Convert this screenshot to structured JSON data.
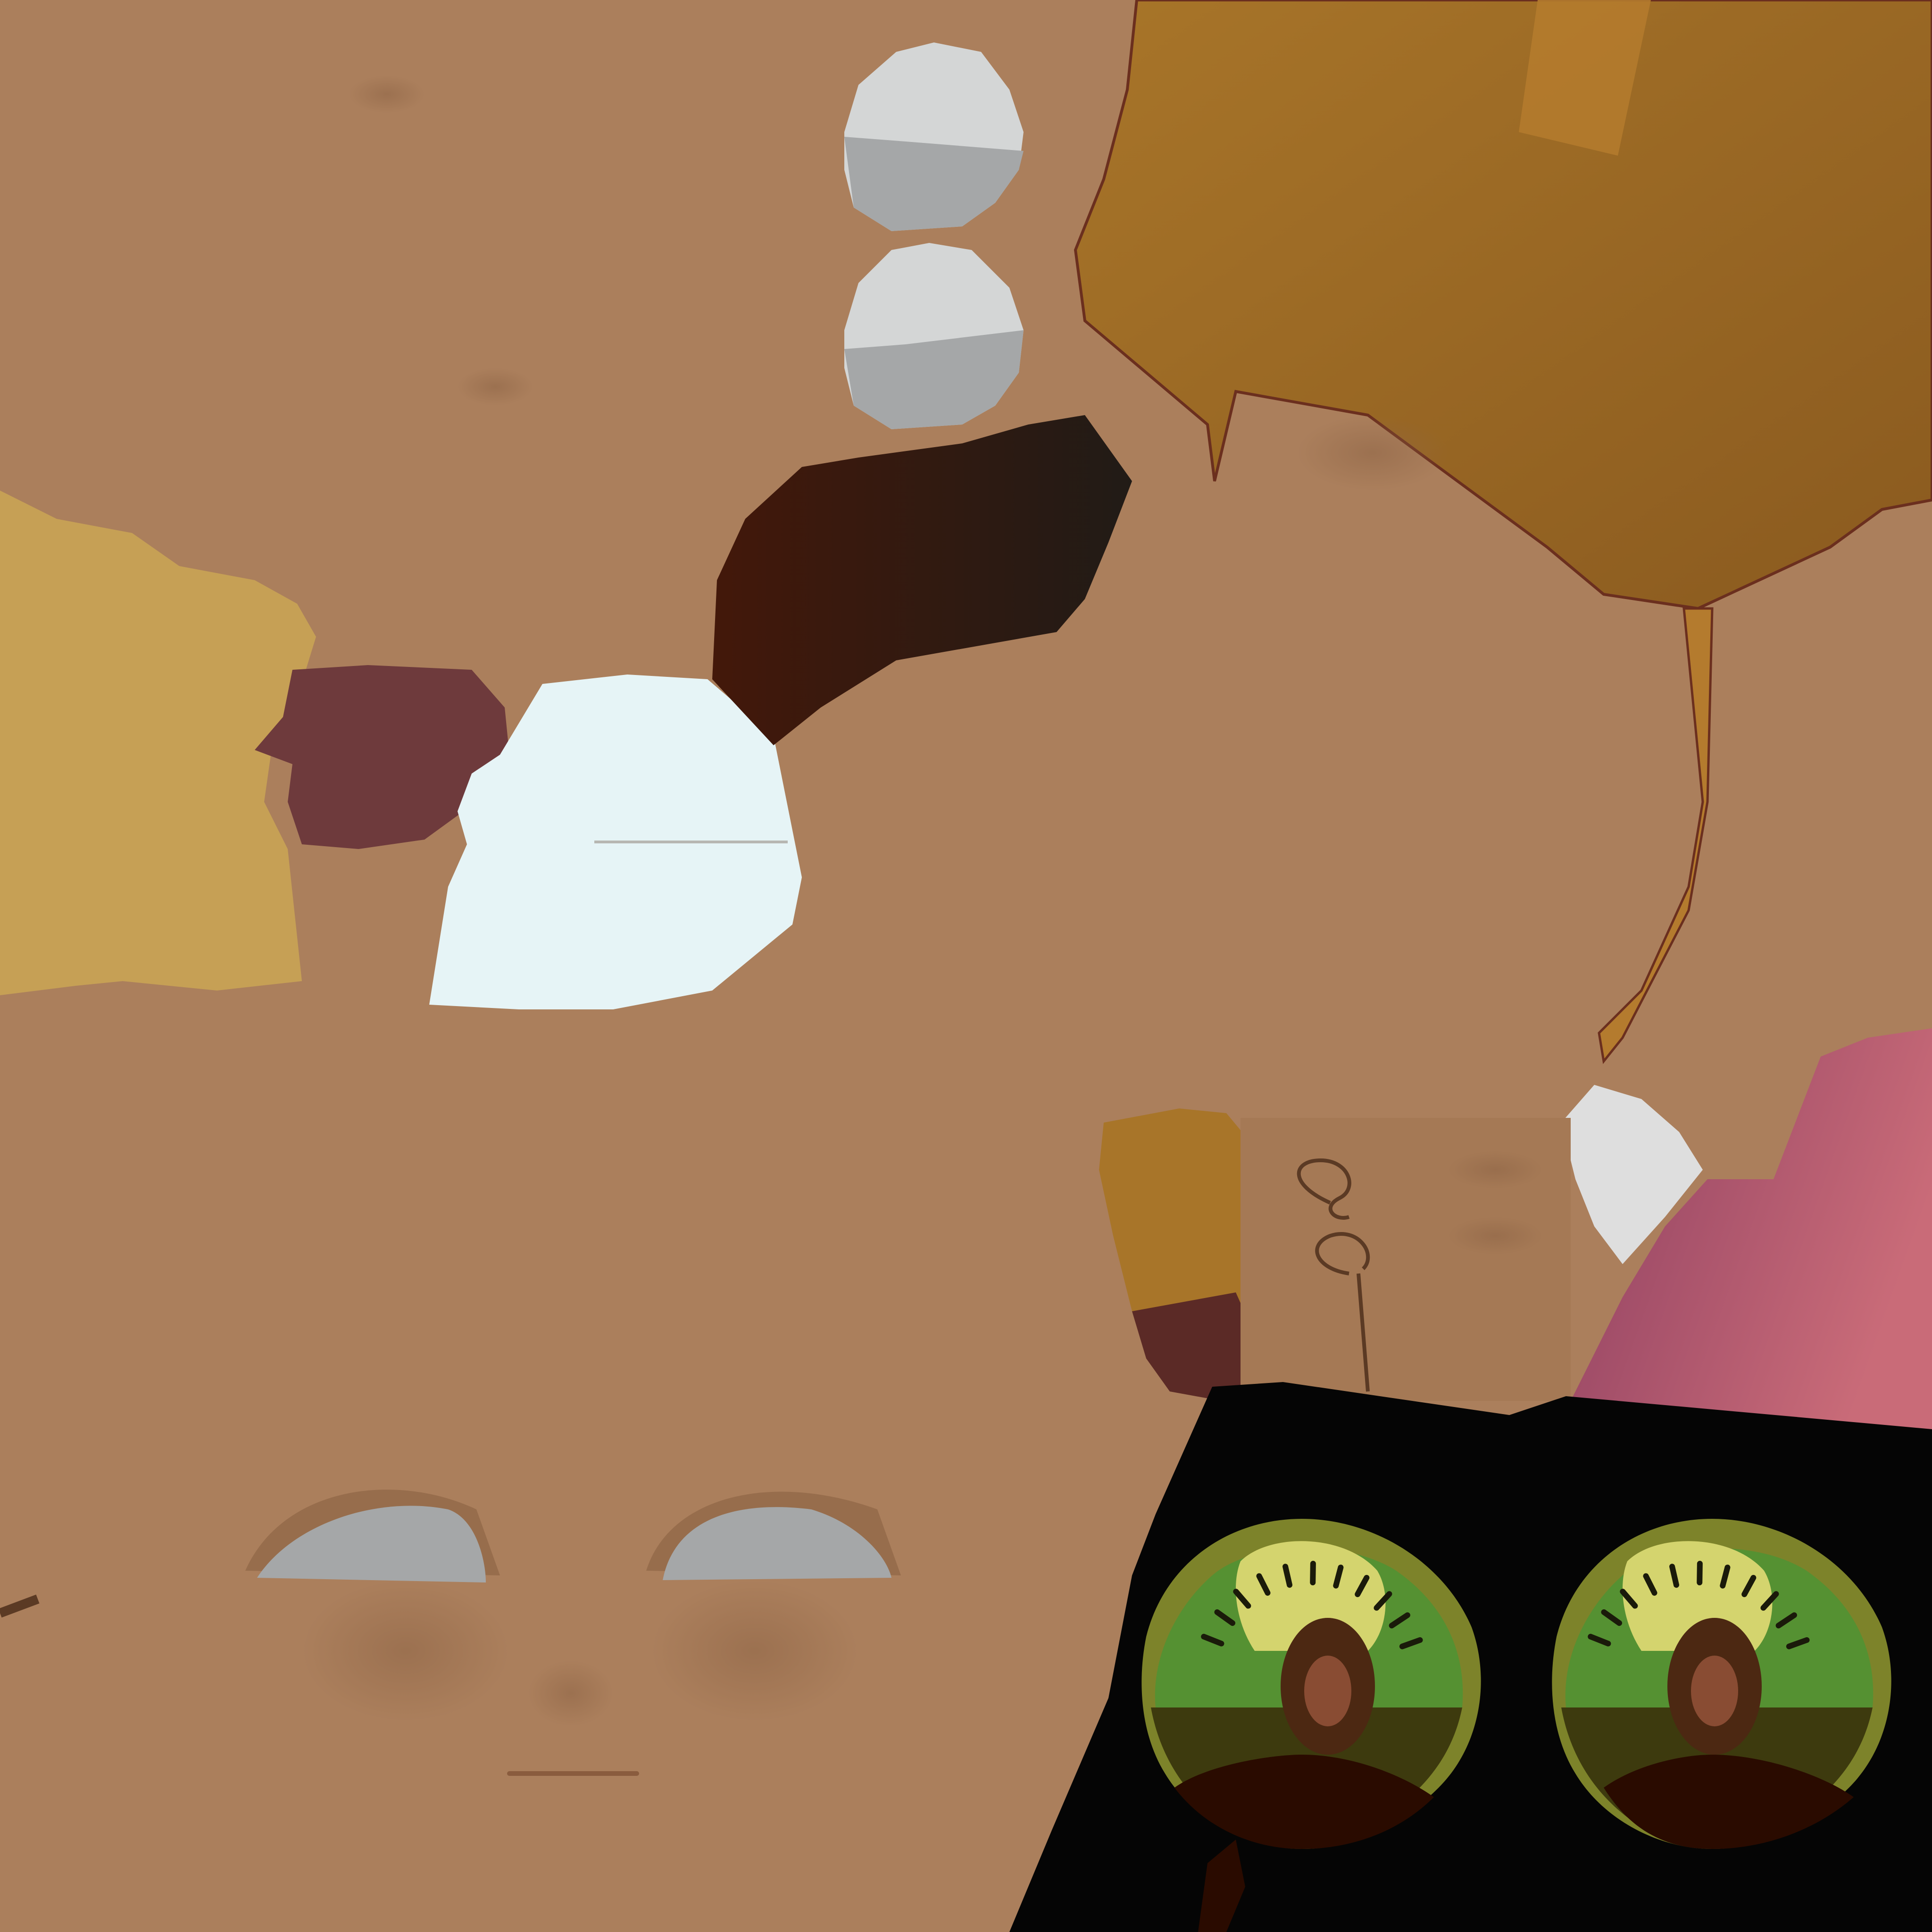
{
  "texture": {
    "colors": {
      "skin": "#ab7f5c",
      "skin_shadow": "#8f6546",
      "gold_hair": "#a87529",
      "gold_hair_dark": "#8a5a1f",
      "blonde": "#c6a055",
      "maroon": "#6e3a3c",
      "dark_brown": "#43180a",
      "near_black": "#211b16",
      "pale_blue": "#e6f4f6",
      "pale_gray": "#d4d6d6",
      "mid_gray": "#a5a7a8",
      "pink": "#c96b78",
      "plum": "#8e3f61",
      "black": "#050505",
      "iris_outer": "#7d832a",
      "iris_green": "#559132",
      "iris_highlight": "#d4d46e",
      "iris_shadow": "#3d3a0e",
      "pupil": "#4c2812",
      "pupil_center": "#894c33",
      "lower_lid": "#2a0b00"
    }
  }
}
